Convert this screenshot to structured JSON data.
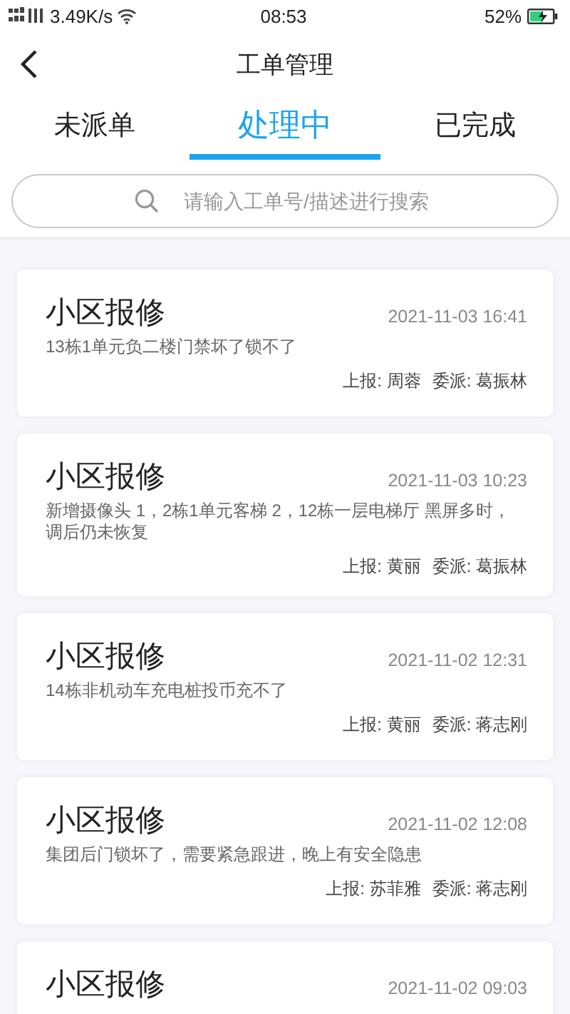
{
  "status_bar": {
    "network_speed": "3.49K/s",
    "time": "08:53",
    "battery": "52%"
  },
  "header": {
    "title": "工单管理"
  },
  "tabs": [
    {
      "label": "未派单",
      "selected": false
    },
    {
      "label": "处理中",
      "selected": true
    },
    {
      "label": "已完成",
      "selected": false
    }
  ],
  "search": {
    "placeholder": "请输入工单号/描述进行搜索"
  },
  "orders": [
    {
      "title": "小区报修",
      "time": "2021-11-03 16:41",
      "description": "13栋1单元负二楼门禁坏了锁不了",
      "reporter": "上报: 周蓉",
      "assignee": "委派: 葛振林"
    },
    {
      "title": "小区报修",
      "time": "2021-11-03 10:23",
      "description": "新增摄像头 1，2栋1单元客梯 2，12栋一层电梯厅 黑屏多时，调后仍未恢复",
      "reporter": "上报: 黄丽",
      "assignee": "委派: 葛振林"
    },
    {
      "title": "小区报修",
      "time": "2021-11-02 12:31",
      "description": "14栋非机动车充电桩投币充不了",
      "reporter": "上报: 黄丽",
      "assignee": "委派: 蒋志刚"
    },
    {
      "title": "小区报修",
      "time": "2021-11-02 12:08",
      "description": "集团后门锁坏了，需要紧急跟进，晚上有安全隐患",
      "reporter": "上报: 苏菲雅",
      "assignee": "委派: 蒋志刚"
    },
    {
      "title": "小区报修",
      "time": "2021-11-02 09:03"
    }
  ]
}
